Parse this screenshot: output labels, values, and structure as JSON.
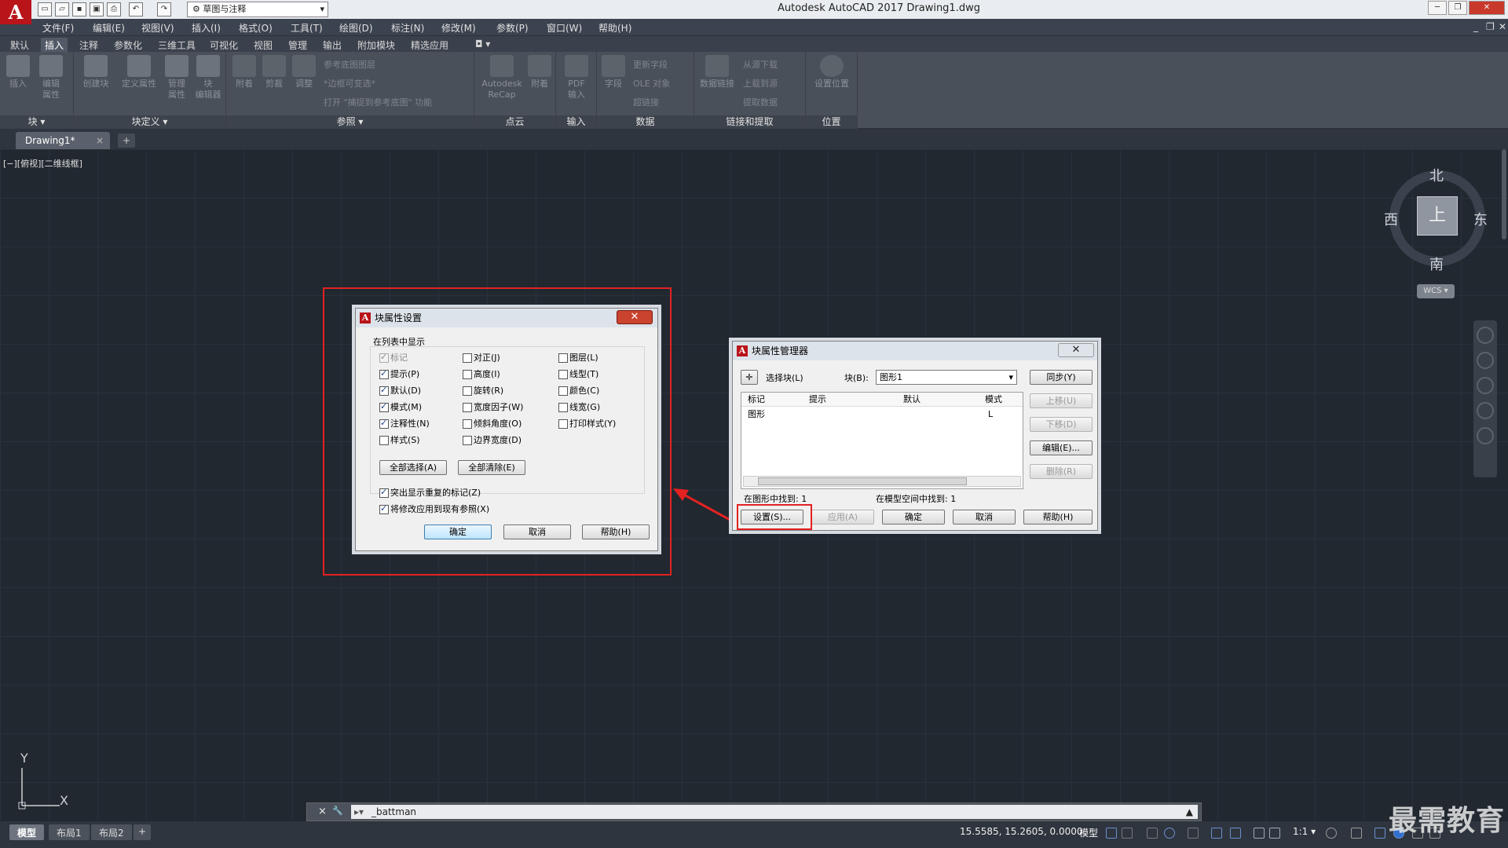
{
  "app": {
    "logo": "A",
    "workspace": "草图与注释",
    "title": "Autodesk AutoCAD 2017    Drawing1.dwg"
  },
  "menus": [
    "文件(F)",
    "编辑(E)",
    "视图(V)",
    "插入(I)",
    "格式(O)",
    "工具(T)",
    "绘图(D)",
    "标注(N)",
    "修改(M)",
    "参数(P)",
    "窗口(W)",
    "帮助(H)"
  ],
  "ribbon_tabs": [
    "默认",
    "插入",
    "注释",
    "参数化",
    "三维工具",
    "可视化",
    "视图",
    "管理",
    "输出",
    "附加模块",
    "精选应用"
  ],
  "ribbon_active_tab": "插入",
  "ribbon": {
    "panel_block": {
      "label": "块 ▾",
      "tools": [
        "插入",
        "编辑\n属性"
      ]
    },
    "panel_blockdef": {
      "label": "块定义 ▾",
      "tools": [
        "创建块",
        "定义属性",
        "管理\n属性",
        "块\n编辑器"
      ]
    },
    "panel_ref": {
      "label": "参照 ▾",
      "tools": [
        "附着",
        "剪裁",
        "调整"
      ],
      "small": [
        "参考底图图层",
        "*边框可变选*",
        "打开 \"捕捉到参考底图\" 功能"
      ]
    },
    "panel_pointcloud": {
      "label": "点云",
      "tools": [
        "Autodesk\nReCap",
        "附着"
      ]
    },
    "panel_import": {
      "label": "输入",
      "tools": [
        "PDF\n输入"
      ]
    },
    "panel_data": {
      "label": "数据",
      "tools": [
        "字段"
      ],
      "small": [
        "更新字段",
        "OLE 对象",
        "超链接"
      ]
    },
    "panel_link": {
      "label": "链接和提取",
      "tools": [
        "数据链接"
      ],
      "small": [
        "从源下载",
        "上载到源",
        "提取数据"
      ]
    },
    "panel_location": {
      "label": "位置",
      "tools": [
        "设置位置"
      ]
    }
  },
  "doc_tab": {
    "name": "Drawing1*",
    "close": "×",
    "new": "+"
  },
  "viewport_label": "[−][俯视][二维线框]",
  "viewcube": {
    "top": "上",
    "north": "北",
    "south": "南",
    "east": "东",
    "west": "西",
    "wcs": "WCS ▾"
  },
  "ucs": {
    "x": "X",
    "y": "Y"
  },
  "command_line": {
    "close": "×",
    "wrench": "🔧",
    "value": "_battman",
    "chev": "▲"
  },
  "layout_tabs": [
    "模型",
    "布局1",
    "布局2"
  ],
  "layout_new": "+",
  "status": {
    "coords": "15.5585, 15.2605, 0.0000",
    "mode": "模型",
    "scale": "1:1 ▾"
  },
  "watermark": "最需教育",
  "dialog_settings": {
    "title": "块属性设置",
    "close": "✕",
    "group_label": "在列表中显示",
    "checkboxes": [
      {
        "label": "标记",
        "checked": true,
        "disabled": true
      },
      {
        "label": "提示(P)",
        "checked": true
      },
      {
        "label": "默认(D)",
        "checked": true
      },
      {
        "label": "模式(M)",
        "checked": true
      },
      {
        "label": "注释性(N)",
        "checked": true
      },
      {
        "label": "样式(S)",
        "checked": false
      },
      {
        "label": "对正(J)",
        "checked": false
      },
      {
        "label": "高度(I)",
        "checked": false
      },
      {
        "label": "旋转(R)",
        "checked": false
      },
      {
        "label": "宽度因子(W)",
        "checked": false
      },
      {
        "label": "倾斜角度(O)",
        "checked": false
      },
      {
        "label": "边界宽度(D)",
        "checked": false
      },
      {
        "label": "图层(L)",
        "checked": false
      },
      {
        "label": "线型(T)",
        "checked": false
      },
      {
        "label": "颜色(C)",
        "checked": false
      },
      {
        "label": "线宽(G)",
        "checked": false
      },
      {
        "label": "打印样式(Y)",
        "checked": false
      }
    ],
    "select_all": "全部选择(A)",
    "clear_all": "全部清除(E)",
    "highlight_dup": {
      "label": "突出显示重复的标记(Z)",
      "checked": true
    },
    "apply_existing": {
      "label": "将修改应用到现有参照(X)",
      "checked": true
    },
    "ok": "确定",
    "cancel": "取消",
    "help": "帮助(H)"
  },
  "dialog_manager": {
    "title": "块属性管理器",
    "close": "✕",
    "select_block": "选择块(L)",
    "block_label": "块(B):",
    "block_value": "图形1",
    "columns": [
      "标记",
      "提示",
      "默认",
      "模式"
    ],
    "rows": [
      [
        "图形",
        "",
        "",
        "L"
      ]
    ],
    "found_in_drawing": "在图形中找到:  1",
    "found_in_model": "在模型空间中找到:  1",
    "side_buttons": [
      {
        "label": "同步(Y)",
        "enabled": true
      },
      {
        "label": "上移(U)",
        "enabled": false
      },
      {
        "label": "下移(D)",
        "enabled": false
      },
      {
        "label": "编辑(E)...",
        "enabled": true
      },
      {
        "label": "删除(R)",
        "enabled": false
      }
    ],
    "settings": "设置(S)...",
    "apply": "应用(A)",
    "ok": "确定",
    "cancel": "取消",
    "help": "帮助(H)"
  },
  "colors": {
    "highlight": "#e32222",
    "canvas": "#212830",
    "ribbon": "#4a505a"
  }
}
